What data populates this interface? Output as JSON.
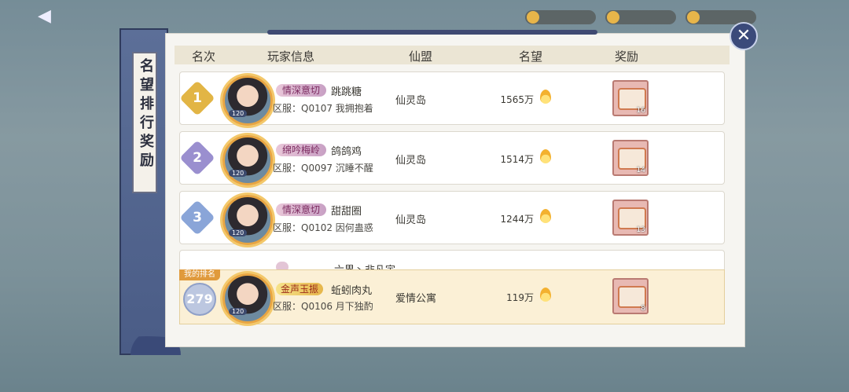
{
  "top_bar": {
    "back_label": "",
    "title": "",
    "resources": [
      "",
      "",
      ""
    ]
  },
  "side_banner": {
    "title": "名望排行奖励"
  },
  "table": {
    "headers": [
      "名次",
      "玩家信息",
      "仙盟",
      "名望",
      "奖励"
    ],
    "rows": [
      {
        "rank": "1",
        "level": "120",
        "title_tag": "情深意切",
        "name": "跳跳糖",
        "server": "区服：Q0107 我拥抱着",
        "alliance": "仙灵岛",
        "fame": "1565万",
        "reward_count": "16",
        "badge_color": "#e2b545"
      },
      {
        "rank": "2",
        "level": "120",
        "title_tag": "绵吟梅岭",
        "name": "鸽鸽鸡",
        "server": "区服：Q0097 沉睡不醒",
        "alliance": "仙灵岛",
        "fame": "1514万",
        "reward_count": "14",
        "badge_color": "#9a8fcf"
      },
      {
        "rank": "3",
        "level": "120",
        "title_tag": "情深意切",
        "name": "甜甜圈",
        "server": "区服：Q0102 因何蛊惑",
        "alliance": "仙灵岛",
        "fame": "1244万",
        "reward_count": "13",
        "badge_color": "#8aa5d8"
      }
    ],
    "partial_row_name": "六界丶非凡宇"
  },
  "my_rank": {
    "tag": "我的排名",
    "rank": "279",
    "level": "120",
    "title_tag": "金声玉振",
    "name": "蚯蚓肉丸",
    "server": "区服：Q0106 月下独酌",
    "alliance": "爱情公寓",
    "fame": "119万",
    "reward_count": "8"
  },
  "close_label": "✕",
  "icons": [
    "back-arrow-icon",
    "close-icon",
    "flame-icon",
    "treasure-chest-icon"
  ]
}
